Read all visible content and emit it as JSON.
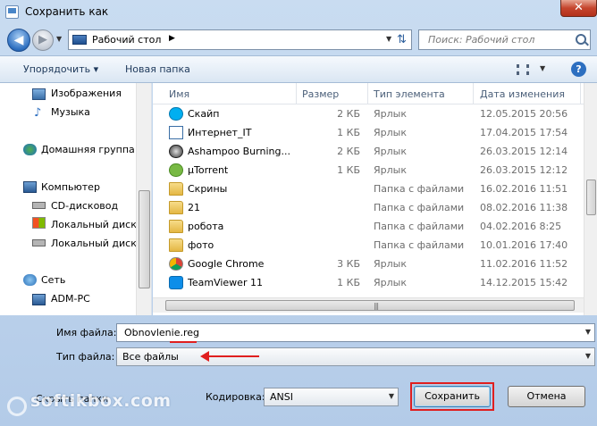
{
  "window": {
    "title": "Сохранить как",
    "close_label": "✕"
  },
  "nav": {
    "address_path": "Рабочий стол",
    "search_placeholder": "Поиск: Рабочий стол"
  },
  "toolbar": {
    "organize_label": "Упорядочить ▾",
    "new_folder_label": "Новая папка",
    "help_label": "?"
  },
  "sidebar": {
    "items": [
      {
        "label": "Изображения",
        "icon": "pictures-icon"
      },
      {
        "label": "Музыка",
        "icon": "music-icon"
      },
      {
        "label": "Домашняя группа",
        "icon": "homegroup-icon"
      },
      {
        "label": "Компьютер",
        "icon": "computer-icon"
      },
      {
        "label": "CD-дисковод",
        "icon": "cd-drive-icon"
      },
      {
        "label": "Локальный диск",
        "icon": "disk-icon"
      },
      {
        "label": "Локальный диск",
        "icon": "disk-icon"
      },
      {
        "label": "Сеть",
        "icon": "network-icon"
      },
      {
        "label": "ADM-PC",
        "icon": "pc-icon"
      }
    ]
  },
  "filelist": {
    "columns": [
      "Имя",
      "Размер",
      "Тип элемента",
      "Дата изменения"
    ],
    "rows": [
      {
        "name": "Скайп",
        "size": "2 КБ",
        "type": "Ярлык",
        "date": "12.05.2015 20:56",
        "icon": "skype-shortcut-icon"
      },
      {
        "name": "Интернет_IT",
        "size": "1 КБ",
        "type": "Ярлык",
        "date": "17.04.2015 17:54",
        "icon": "shortcut-icon"
      },
      {
        "name": "Ashampoo Burning...",
        "size": "2 КБ",
        "type": "Ярлык",
        "date": "26.03.2015 12:14",
        "icon": "ashampoo-icon"
      },
      {
        "name": "µTorrent",
        "size": "1 КБ",
        "type": "Ярлык",
        "date": "26.03.2015 12:12",
        "icon": "utorrent-icon"
      },
      {
        "name": "Скрины",
        "size": "",
        "type": "Папка с файлами",
        "date": "16.02.2016 11:51",
        "icon": "folder-icon"
      },
      {
        "name": "21",
        "size": "",
        "type": "Папка с файлами",
        "date": "08.02.2016 11:38",
        "icon": "folder-icon"
      },
      {
        "name": "робота",
        "size": "",
        "type": "Папка с файлами",
        "date": "04.02.2016 8:25",
        "icon": "folder-icon"
      },
      {
        "name": "фото",
        "size": "",
        "type": "Папка с файлами",
        "date": "10.01.2016 17:40",
        "icon": "folder-icon"
      },
      {
        "name": "Google Chrome",
        "size": "3 КБ",
        "type": "Ярлык",
        "date": "11.02.2016 11:52",
        "icon": "chrome-icon"
      },
      {
        "name": "TeamViewer 11",
        "size": "1 КБ",
        "type": "Ярлык",
        "date": "14.12.2015 15:42",
        "icon": "teamviewer-icon"
      }
    ]
  },
  "form": {
    "filename_label": "Имя файла:",
    "filename_value": "Obnovlenie.reg",
    "filetype_label": "Тип файла:",
    "filetype_value": "Все файлы",
    "encoding_label": "Кодировка:",
    "encoding_value": "ANSI",
    "hide_folders_label": "Скрыть папки",
    "save_label": "Сохранить",
    "cancel_label": "Отмена"
  },
  "watermark": "softikbox.com",
  "colors": {
    "accent": "#2d6fc0",
    "highlight": "#e01f1f"
  }
}
